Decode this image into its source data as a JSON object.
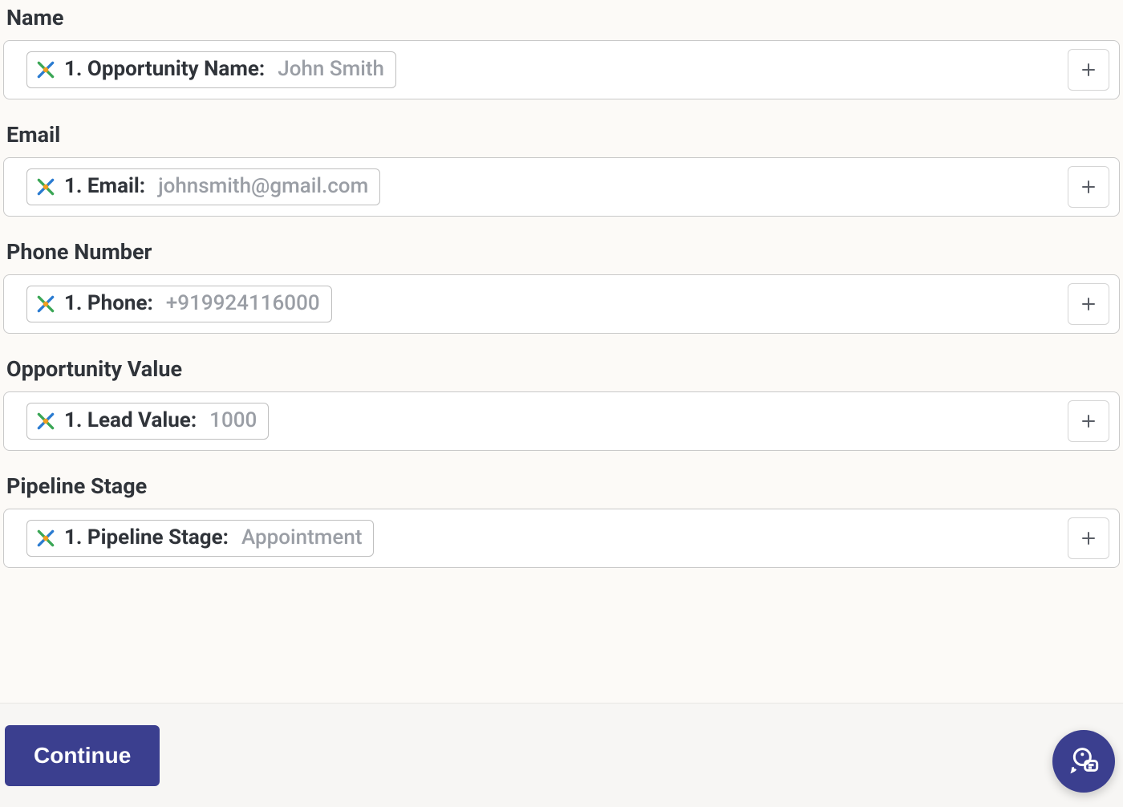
{
  "fields": [
    {
      "label": "Name",
      "tag_key": "1. Opportunity Name:",
      "tag_value": "John Smith"
    },
    {
      "label": "Email",
      "tag_key": "1. Email:",
      "tag_value": "johnsmith@gmail.com"
    },
    {
      "label": "Phone Number",
      "tag_key": "1. Phone:",
      "tag_value": "+919924116000"
    },
    {
      "label": "Opportunity Value",
      "tag_key": "1. Lead Value:",
      "tag_value": "1000"
    },
    {
      "label": "Pipeline Stage",
      "tag_key": "1. Pipeline Stage:",
      "tag_value": "Appointment"
    }
  ],
  "actions": {
    "continue_label": "Continue"
  },
  "colors": {
    "primary": "#3b3f8f"
  }
}
